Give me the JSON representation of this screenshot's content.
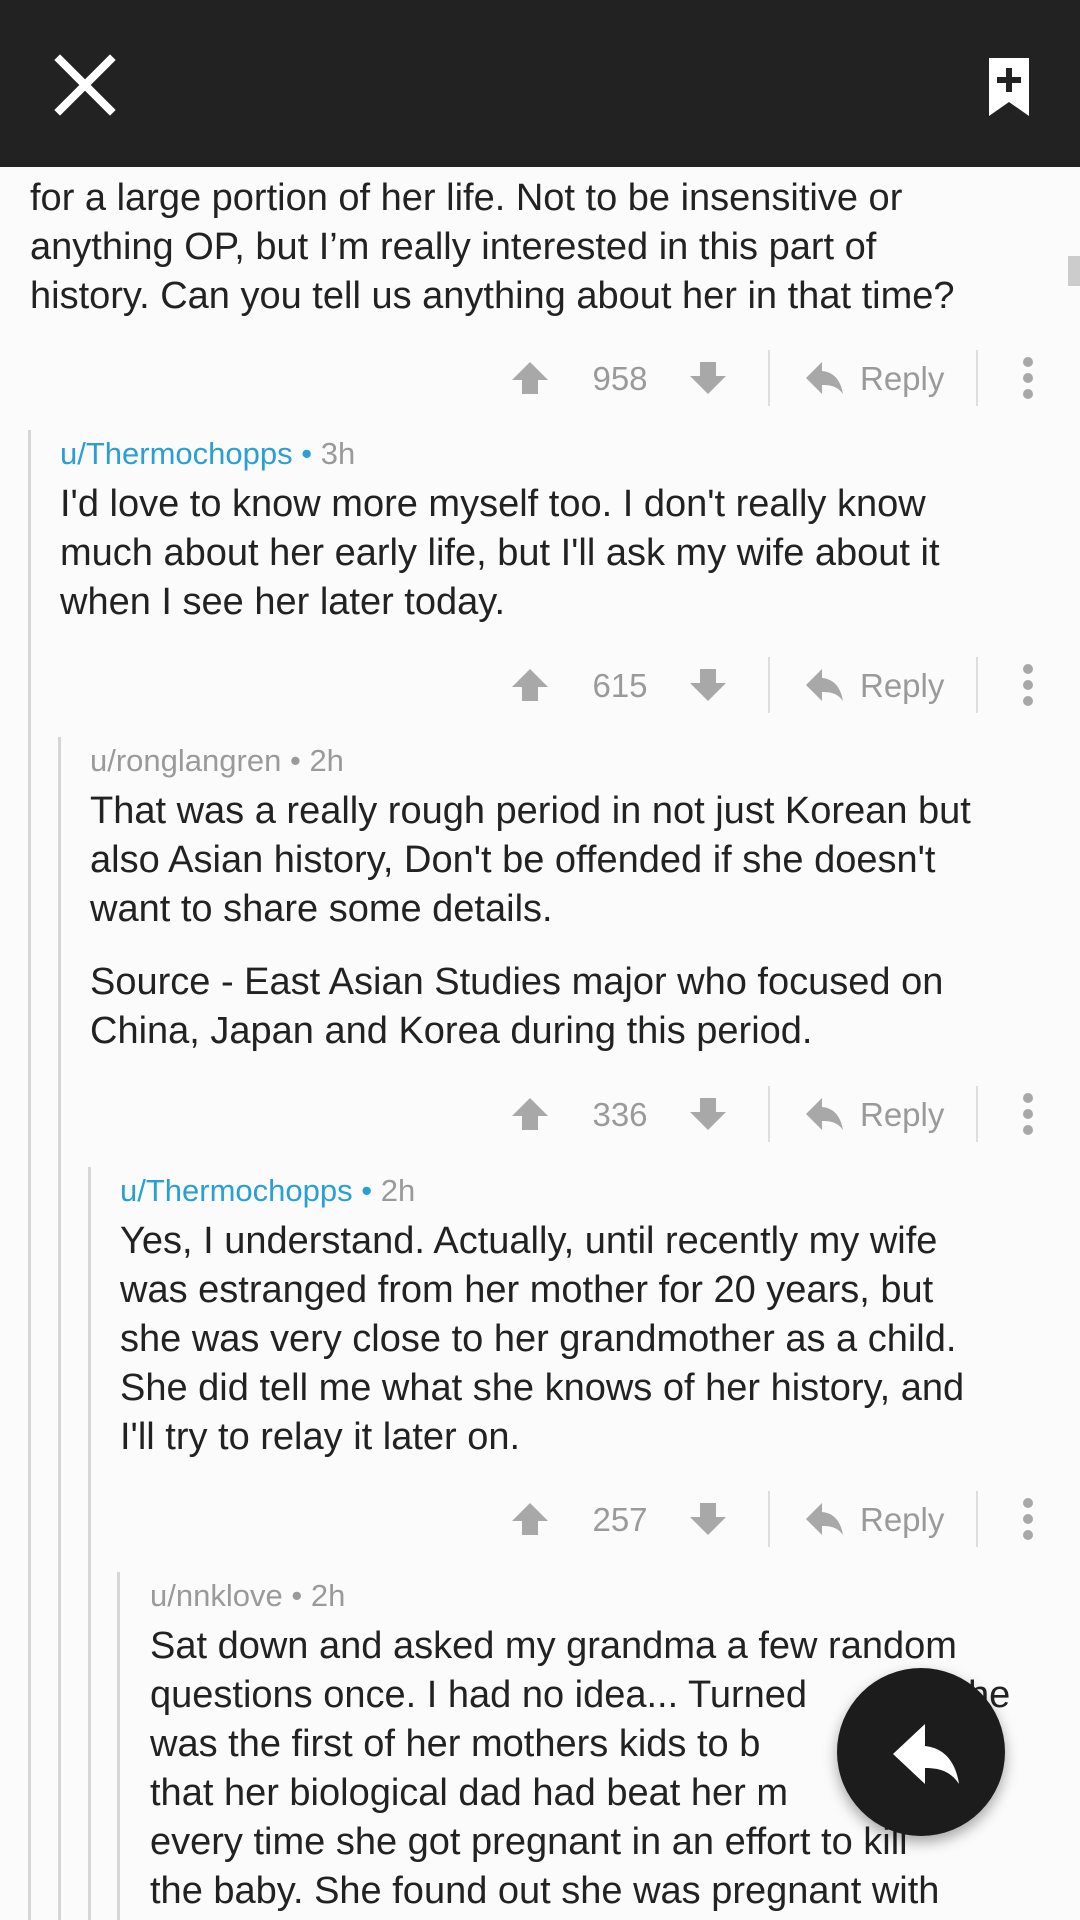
{
  "icons": {
    "close": "close-icon",
    "bookmark": "bookmark-add-icon",
    "upvote": "arrow-up-icon",
    "downvote": "arrow-down-icon",
    "reply": "reply-icon",
    "more": "more-vertical-icon",
    "fab": "reply-icon"
  },
  "colors": {
    "topbar": "#222222",
    "username_op": "#2a9fd6",
    "username_other": "#9a9a9a",
    "text": "#222222",
    "muted": "#9a9a9a",
    "fab": "#1c1c1c"
  },
  "comments": [
    {
      "author": "",
      "time": "",
      "body": [
        "for a large portion of her life. Not to be insensitive or\nanything OP, but I’m really interested in this part of\nhistory. Can you tell us anything about her in that time?"
      ],
      "score": "958",
      "reply_label": "Reply"
    },
    {
      "author": "u/Thermochopps",
      "separator": "•",
      "time": "3h",
      "body": [
        "I'd love to know more myself too. I don't really know\nmuch about her early life, but I'll ask my wife about it\nwhen I see her later today."
      ],
      "score": "615",
      "reply_label": "Reply"
    },
    {
      "author": "u/ronglangren",
      "separator": "•",
      "time": "2h",
      "body": [
        "That was a really rough period in not just Korean but\nalso Asian history, Don't be offended if she doesn't\nwant to share some details.",
        "Source - East Asian Studies major who focused on\nChina, Japan and Korea during this period."
      ],
      "score": "336",
      "reply_label": "Reply"
    },
    {
      "author": "u/Thermochopps",
      "separator": "•",
      "time": "2h",
      "body": [
        "Yes, I understand. Actually, until recently my wife\nwas estranged from her mother for 20 years, but\nshe was very close to her grandmother as a child.\nShe did tell me what she knows of her history, and\nI'll try to relay it later on."
      ],
      "score": "257",
      "reply_label": "Reply"
    },
    {
      "author": "u/nnklove",
      "separator": "•",
      "time": "2h",
      "body": [
        "Sat down and asked my grandma a few random\nquestions once. I had no idea... Turned\nwas the first of her mothers kids to b\nthat her biological dad had beat her m\nevery time she got pregnant in an effort to kill\nthe baby. She found out she was pregnant with"
      ],
      "body_tail": "he"
    }
  ]
}
